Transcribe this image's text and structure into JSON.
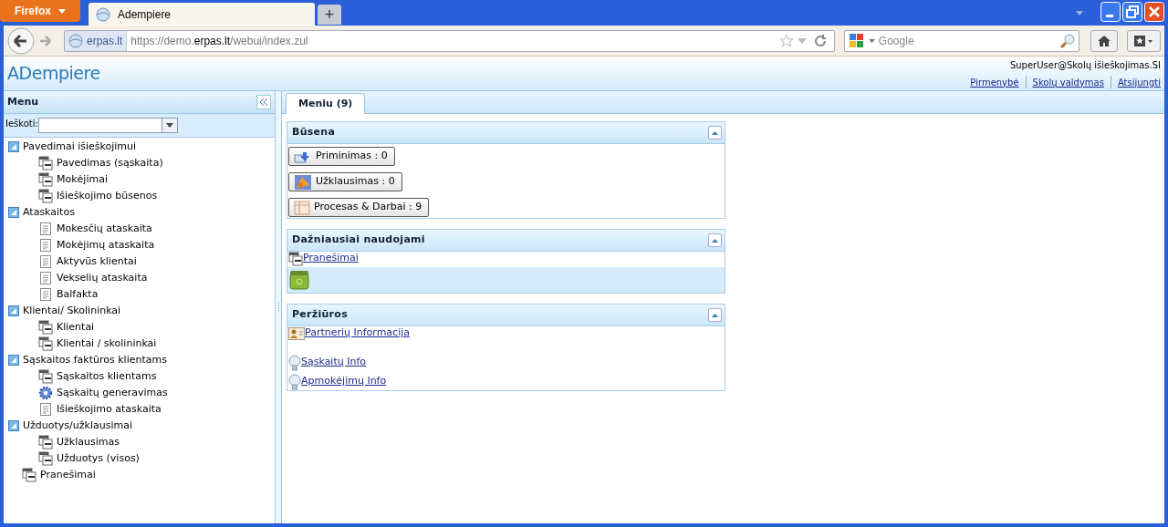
{
  "browser": {
    "app_button": "Firefox",
    "tab_title": "Adempiere",
    "new_tab": "+",
    "site_badge": "erpas.lt",
    "url_prefix": "https://demo.",
    "url_domain": "erpas.lt",
    "url_path": "/webui/index.zul",
    "search_placeholder": "Google"
  },
  "header": {
    "logo": "ADempiere",
    "user": "SuperUser@Skolų išieškojimas.SI",
    "links": [
      "Pirmenybė",
      "Skolų valdymas",
      "Atsijungti"
    ]
  },
  "menu": {
    "title": "Menu",
    "search_label": "Ieškoti:",
    "items": [
      {
        "label": "Pavedimai išieškojimui",
        "kind": "folder",
        "expanded": true,
        "children": [
          {
            "label": "Pavedimas (sąskaita)",
            "kind": "window"
          },
          {
            "label": "Mokėjimai",
            "kind": "window"
          },
          {
            "label": "Išieškojimo būsenos",
            "kind": "window"
          }
        ]
      },
      {
        "label": "Ataskaitos",
        "kind": "folder",
        "expanded": true,
        "children": [
          {
            "label": "Mokesčių ataskaita",
            "kind": "report"
          },
          {
            "label": "Mokėjimų ataskaita",
            "kind": "report"
          },
          {
            "label": "Aktyvūs klientai",
            "kind": "report"
          },
          {
            "label": "Vekselių ataskaita",
            "kind": "report"
          },
          {
            "label": "Balfakta",
            "kind": "report"
          }
        ]
      },
      {
        "label": "Klientai/ Skolininkai",
        "kind": "folder",
        "expanded": true,
        "children": [
          {
            "label": "Klientai",
            "kind": "window"
          },
          {
            "label": "Klientai / skolininkai",
            "kind": "window"
          }
        ]
      },
      {
        "label": "Sąskaitos faktūros klientams",
        "kind": "folder",
        "expanded": true,
        "children": [
          {
            "label": "Sąskaitos klientams",
            "kind": "window"
          },
          {
            "label": "Sąskaitų generavimas",
            "kind": "process"
          },
          {
            "label": "Išieškojimo ataskaita",
            "kind": "report"
          }
        ]
      },
      {
        "label": "Užduotys/užklausimai",
        "kind": "folder",
        "expanded": true,
        "children": [
          {
            "label": "Užklausimas",
            "kind": "window"
          },
          {
            "label": "Užduotys (visos)",
            "kind": "window"
          }
        ]
      },
      {
        "label": "Pranešimai",
        "kind": "window"
      }
    ]
  },
  "tabs": [
    {
      "label": "Meniu (9)",
      "selected": true
    }
  ],
  "panels": [
    {
      "title": "Būsena",
      "kind": "buttons",
      "items": [
        {
          "label": "Priminimas : 0",
          "kind": "reminder"
        },
        {
          "label": "Užklausimas : 0",
          "kind": "request"
        },
        {
          "label": "Procesas & Darbai : 9",
          "kind": "workflow"
        }
      ]
    },
    {
      "title": "Dažniausiai naudojami",
      "kind": "favorites",
      "items": [
        {
          "label": "Pranešimai",
          "kind": "window"
        }
      ]
    },
    {
      "title": "Peržiūros",
      "kind": "links",
      "items": [
        {
          "label": "Partnerių Informacija",
          "kind": "partner"
        },
        {
          "label": "Sąskaitų Info",
          "kind": "info"
        },
        {
          "label": "Apmokėjimų Info",
          "kind": "info"
        }
      ]
    }
  ]
}
